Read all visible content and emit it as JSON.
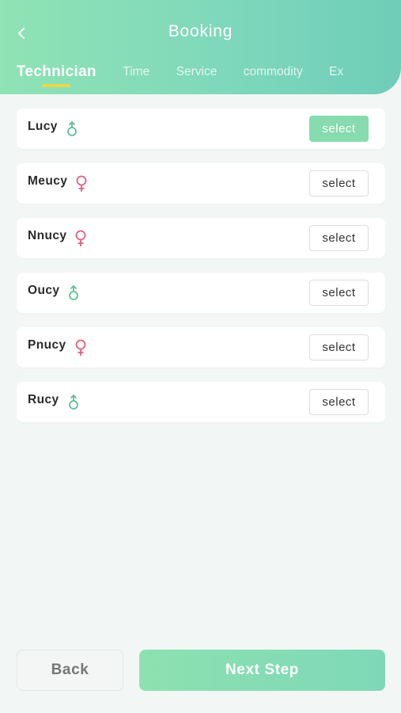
{
  "header": {
    "title": "Booking",
    "back_icon": "chevron-left-icon",
    "tabs": [
      {
        "label": "Technician",
        "active": true
      },
      {
        "label": "Time",
        "active": false
      },
      {
        "label": "Service",
        "active": false
      },
      {
        "label": "commodity",
        "active": false
      },
      {
        "label": "Ex",
        "active": false
      }
    ]
  },
  "technicians": [
    {
      "name": "Lucy",
      "gender": "male",
      "button": "select",
      "selected": true
    },
    {
      "name": "Meucy",
      "gender": "female",
      "button": "select",
      "selected": false
    },
    {
      "name": "Nnucy",
      "gender": "female",
      "button": "select",
      "selected": false
    },
    {
      "name": "Oucy",
      "gender": "male",
      "button": "select",
      "selected": false
    },
    {
      "name": "Pnucy",
      "gender": "female",
      "button": "select",
      "selected": false
    },
    {
      "name": "Rucy",
      "gender": "male",
      "button": "select",
      "selected": false
    }
  ],
  "footer": {
    "back_label": "Back",
    "next_label": "Next Step"
  },
  "colors": {
    "accent": "#86dcae",
    "male": "#5fbf97",
    "female": "#e0607a",
    "tab_indicator": "#e8d94a"
  }
}
